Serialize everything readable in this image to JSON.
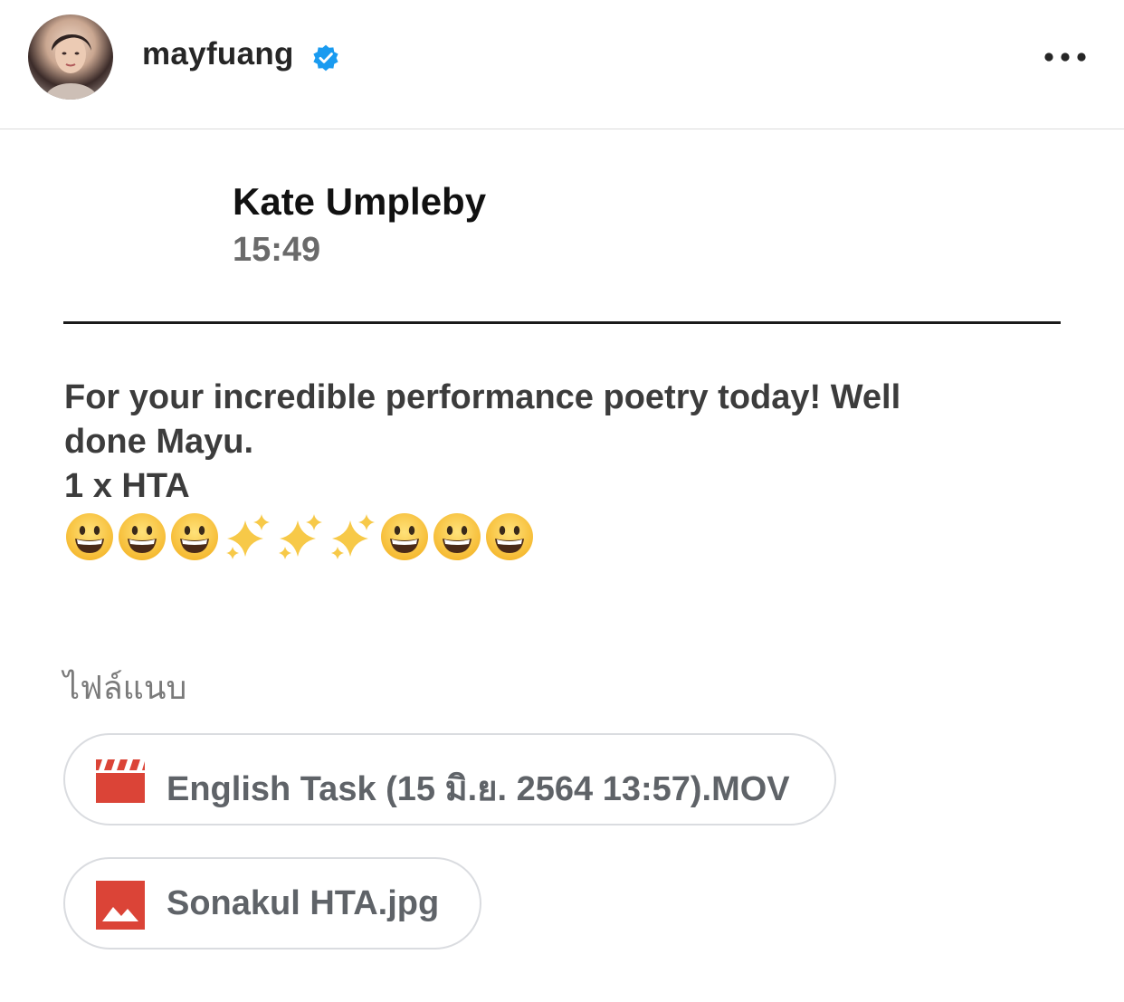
{
  "header": {
    "username": "mayfuang",
    "verified_icon": "verified-badge-icon",
    "more_icon": "more-horizontal-icon",
    "avatar": "profile-avatar"
  },
  "message_card": {
    "sender": "Kate Umpleby",
    "time": "15:49",
    "body_lines": [
      "For your incredible performance poetry today! Well",
      "done Mayu.",
      "1 x HTA"
    ],
    "emojis": [
      "grinning-face",
      "grinning-face",
      "grinning-face",
      "sparkles",
      "sparkles",
      "sparkles",
      "grinning-face",
      "grinning-face",
      "grinning-face"
    ],
    "attachments_label": "ไฟล์แนบ",
    "attachments": [
      {
        "name": "English Task (15 มิ.ย. 2564 13:57).MOV",
        "icon": "video-clapperboard-icon",
        "icon_color": "#db4437"
      },
      {
        "name": "Sonakul HTA.jpg",
        "icon": "image-icon",
        "icon_color": "#db4437"
      }
    ]
  },
  "colors": {
    "verified": "#1a9bf0",
    "divider": "#1a1a1a",
    "chip_border": "#dadce0",
    "attachment_icon": "#db4437"
  }
}
